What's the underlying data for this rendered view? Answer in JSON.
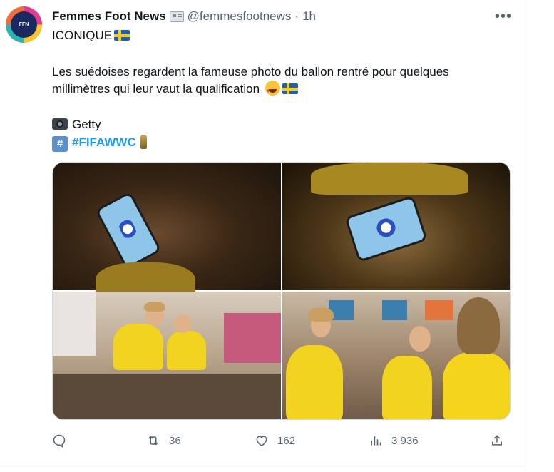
{
  "tweet": {
    "author_name": "Femmes Foot News",
    "author_handle": "@femmesfootnews",
    "separator": "·",
    "time": "1h",
    "avatar_text": "FFN",
    "line1": "ICONIQUE",
    "line2": "Les suédoises regardent la fameuse photo du ballon rentré pour quelques",
    "line3": "millimètres qui leur vaut la qualification",
    "credit": "Getty",
    "hashtag": "#FIFAWWC"
  },
  "actions": {
    "replies": "",
    "retweets": "36",
    "likes": "162",
    "views": "3 936"
  },
  "icons": [
    "more-icon",
    "newspaper-icon",
    "sweden-flag-icon",
    "heart-eyes-icon",
    "camera-icon",
    "hashtag-icon",
    "trophy-icon",
    "reply-icon",
    "retweet-icon",
    "like-icon",
    "views-icon",
    "share-icon"
  ],
  "colors": {
    "accent": "#1d9bf0",
    "muted": "#536471",
    "text": "#0f1419"
  }
}
